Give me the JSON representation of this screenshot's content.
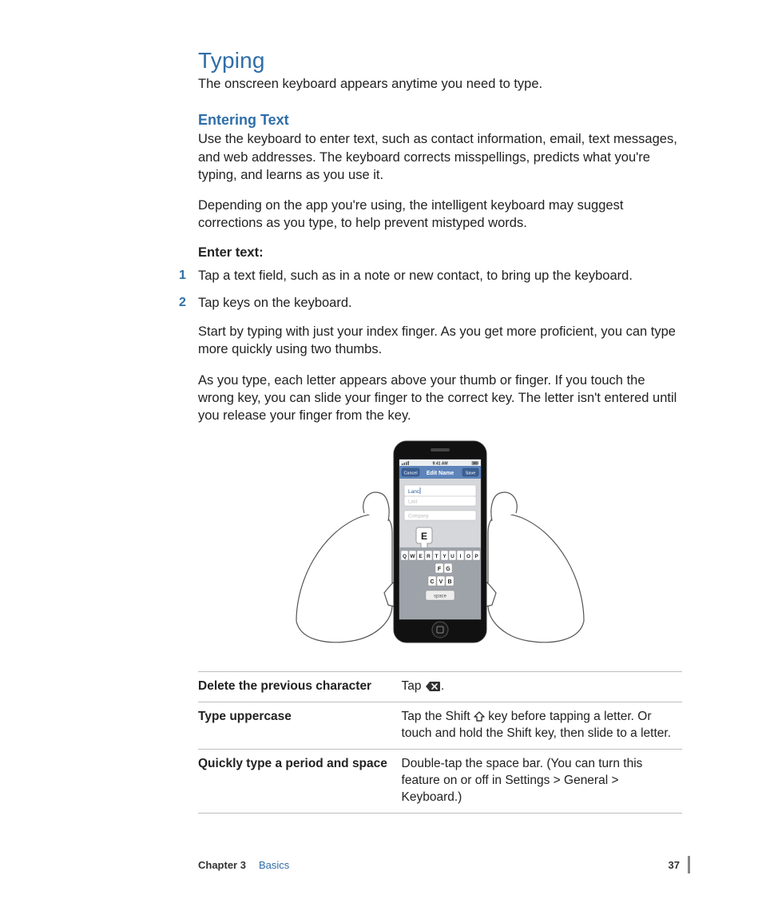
{
  "section": {
    "title": "Typing",
    "lead": "The onscreen keyboard appears anytime you need to type."
  },
  "subsection": {
    "title": "Entering Text",
    "p1": "Use the keyboard to enter text, such as contact information, email, text messages, and web addresses. The keyboard corrects misspellings, predicts what you're typing, and learns as you use it.",
    "p2": "Depending on the app you're using, the intelligent keyboard may suggest corrections as you type, to help prevent mistyped words."
  },
  "steps": {
    "label": "Enter text:",
    "items": [
      {
        "num": "1",
        "text": "Tap a text field, such as in a note or new contact, to bring up the keyboard."
      },
      {
        "num": "2",
        "text": "Tap keys on the keyboard."
      }
    ],
    "after1": "Start by typing with just your index finger. As you get more proficient, you can type more quickly using two thumbs.",
    "after2": "As you type, each letter appears above your thumb or finger. If you touch the wrong key, you can slide your finger to the correct key. The letter isn't entered until you release your finger from the key."
  },
  "phone_ui": {
    "nav_left": "Cancel",
    "nav_title": "Edit Name",
    "nav_right": "Save",
    "status_time": "9:41 AM",
    "field_first": "Lanc",
    "field_last": "Last",
    "field_company": "Company",
    "popup_key": "E",
    "row1": [
      "Q",
      "W",
      "E",
      "R",
      "T",
      "Y",
      "U",
      "I",
      "O",
      "P"
    ],
    "row2_mid": [
      "F",
      "G"
    ],
    "row3_mid": [
      "C",
      "V",
      "B"
    ],
    "space": "space"
  },
  "table": {
    "rows": [
      {
        "label": "Delete the previous character",
        "text_before": "Tap ",
        "icon": "delete",
        "text_after": "."
      },
      {
        "label": "Type uppercase",
        "text_before": "Tap the Shift ",
        "icon": "shift",
        "text_after": " key before tapping a letter. Or touch and hold the Shift key, then slide to a letter."
      },
      {
        "label": "Quickly type a period and space",
        "text_before": "Double-tap the space bar. (You can turn this feature on or off in Settings > General > Keyboard.)",
        "icon": "",
        "text_after": ""
      }
    ]
  },
  "footer": {
    "chapter_label": "Chapter 3",
    "chapter_name": "Basics",
    "page_number": "37"
  }
}
